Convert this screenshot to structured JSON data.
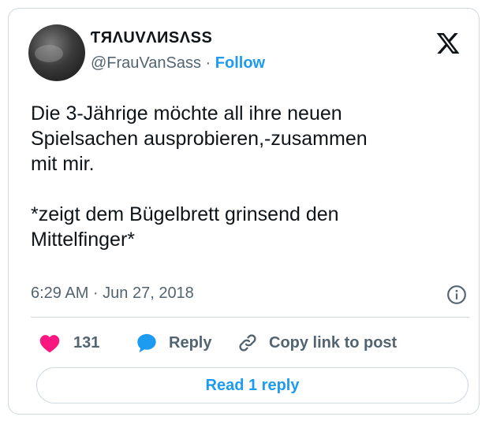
{
  "author": {
    "display_name": "ƬЯΛUVΛИSΛSS",
    "handle": "@FrauVanSass",
    "separator": " · ",
    "follow_label": "Follow"
  },
  "tweet": {
    "text": "Die 3-Jährige möchte all ihre neuen\nSpielsachen ausprobieren,-zusammen\nmit mir.\n\n*zeigt dem Bügelbrett grinsend den\nMittelfinger*",
    "timestamp": "6:29 AM · Jun 27, 2018"
  },
  "actions": {
    "like_count": "131",
    "reply_label": "Reply",
    "copy_link_label": "Copy link to post"
  },
  "read_reply_label": "Read 1 reply",
  "icons": {
    "brand": "x-logo-icon",
    "info": "info-icon",
    "like": "heart-icon",
    "reply": "speech-bubble-icon",
    "copy": "link-icon"
  },
  "colors": {
    "accent": "#1d9bf0",
    "heart": "#f91880",
    "secondary_text": "#536471",
    "border": "#cfd9de"
  }
}
